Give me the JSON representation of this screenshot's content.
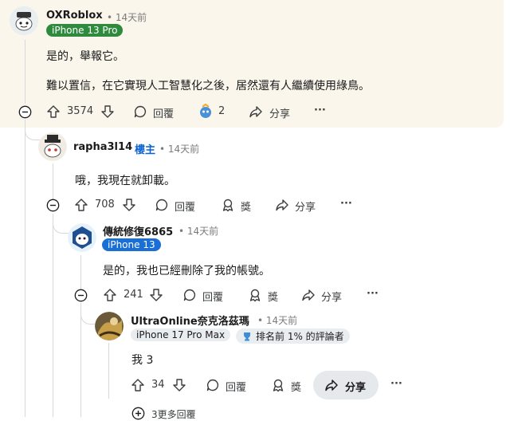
{
  "comments": [
    {
      "username": "OXRoblox",
      "time": "• 14天前",
      "flair": "iPhone 13 Pro",
      "body": [
        "是的，舉報它。",
        "難以置信，在它實現人工智慧化之後，居然還有人繼續使用綠鳥。"
      ],
      "votes": "3574",
      "reply_label": "回覆",
      "award_count": "2",
      "share_label": "分享",
      "more_label": "···"
    },
    {
      "username": "rapha3l14",
      "op_badge": "樓主",
      "time": "• 14天前",
      "body": [
        "哦，我現在就卸載。"
      ],
      "votes": "708",
      "reply_label": "回覆",
      "award_label": "獎",
      "share_label": "分享",
      "more_label": "···"
    },
    {
      "username": "傳統修復6865",
      "time": "• 14天前",
      "flair": "iPhone 13",
      "body": [
        "是的，我也已經刪除了我的帳號。"
      ],
      "votes": "241",
      "reply_label": "回覆",
      "award_label": "獎",
      "share_label": "分享",
      "more_label": "···"
    },
    {
      "username": "UltraOnline奈克洛茲瑪",
      "time": "• 14天前",
      "flair": "iPhone 17 Pro Max",
      "achievement": "排名前 1% 的評論者",
      "body": [
        "我 3"
      ],
      "votes": "34",
      "reply_label": "回覆",
      "award_label": "獎",
      "share_label": "分享",
      "more_label": "···"
    }
  ],
  "more_replies": "3更多回覆",
  "colors": {
    "highlight_bg": "#fbf6ec",
    "green_flair": "#2e8b3e",
    "blue_flair": "#1a6fd6",
    "op_blue": "#0b63d1"
  }
}
